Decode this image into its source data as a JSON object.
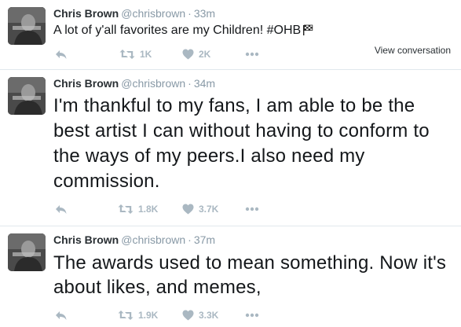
{
  "tweets": [
    {
      "fullname": "Chris Brown",
      "username": "@chrisbrown",
      "separator": "·",
      "time": "33m",
      "text": "A lot of y'all favorites are my Children! #OHB",
      "retweets": "1K",
      "likes": "2K",
      "view_conversation": "View conversation"
    },
    {
      "fullname": "Chris Brown",
      "username": "@chrisbrown",
      "separator": "·",
      "time": "34m",
      "text": "I'm thankful to my fans, I am able to be the best artist I can without having to conform to the ways of my peers.I also need my commission.",
      "retweets": "1.8K",
      "likes": "3.7K"
    },
    {
      "fullname": "Chris Brown",
      "username": "@chrisbrown",
      "separator": "·",
      "time": "37m",
      "text": "The awards used to mean something. Now it's about likes, and memes,",
      "retweets": "1.9K",
      "likes": "3.3K"
    }
  ],
  "icons": {
    "reply": "reply-icon",
    "retweet": "retweet-icon",
    "like": "heart-icon",
    "more": "more-dots-icon",
    "flag": "checkered-flag-icon"
  },
  "colors": {
    "action_gray": "#aab8c2",
    "meta_gray": "#8899a6",
    "text": "#14171a",
    "divider": "#e1e8ed"
  }
}
